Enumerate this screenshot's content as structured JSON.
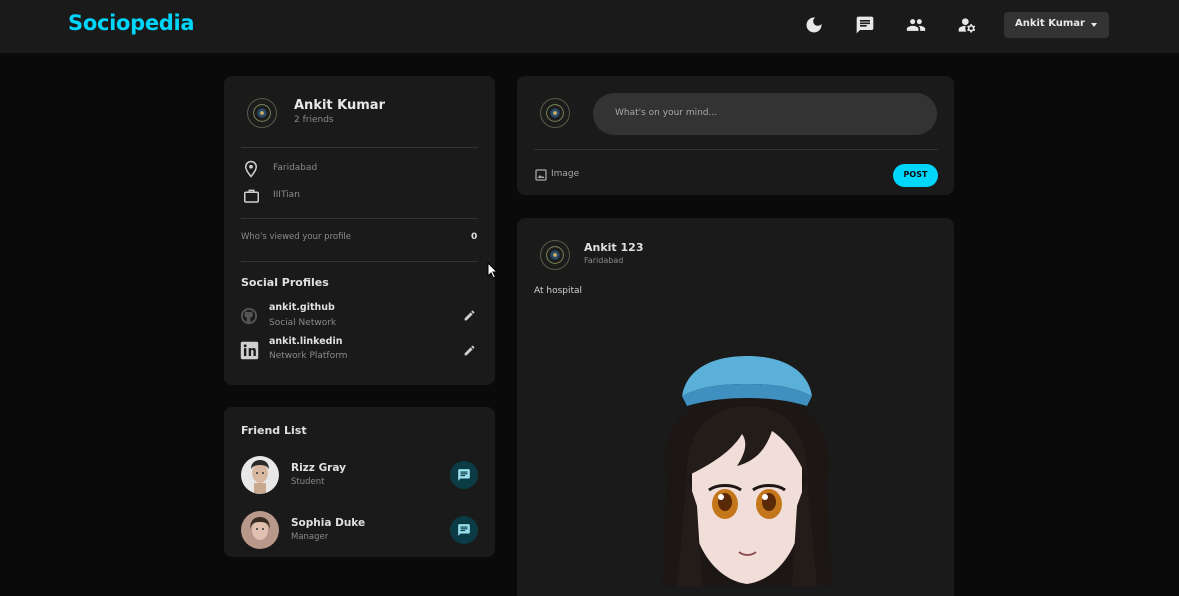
{
  "app": {
    "brand": "Sociopedia",
    "user_menu_label": "Ankit Kumar"
  },
  "navbar": {
    "icons": [
      "dark-mode-icon",
      "message-icon",
      "people-icon",
      "manage-accounts-icon"
    ]
  },
  "profile": {
    "name": "Ankit Kumar",
    "friends": "2 friends",
    "location": "Faridabad",
    "occupation": "IIITian",
    "viewed_label": "Who's viewed your profile",
    "viewed_count": "0",
    "social_title": "Social Profiles",
    "social": [
      {
        "handle": "ankit.github",
        "type": "Social Network",
        "icon": "github-icon"
      },
      {
        "handle": "ankit.linkedin",
        "type": "Network Platform",
        "icon": "linkedin-icon"
      }
    ]
  },
  "friend_list": {
    "title": "Friend List",
    "friends": [
      {
        "name": "Rizz Gray",
        "role": "Student"
      },
      {
        "name": "Sophia Duke",
        "role": "Manager"
      }
    ]
  },
  "composer": {
    "placeholder": "What's on your mind...",
    "image_label": "Image",
    "post_label": "POST"
  },
  "feed": {
    "post": {
      "author": "Ankit 123",
      "location": "Faridabad",
      "text": "At hospital"
    }
  },
  "colors": {
    "accent": "#00d5fa",
    "background": "#0a0a0a",
    "card": "#1a1a1a"
  }
}
